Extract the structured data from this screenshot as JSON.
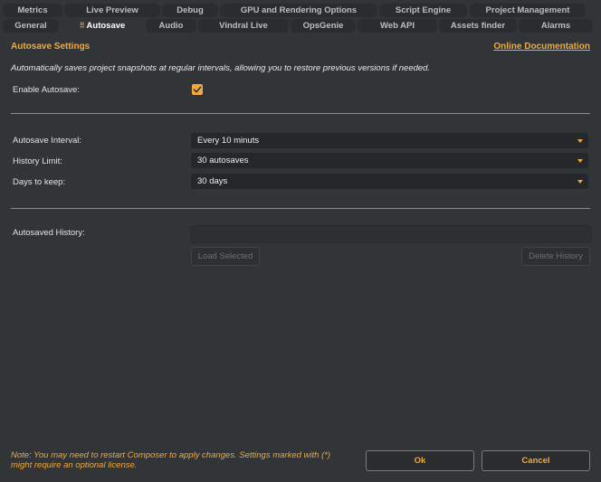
{
  "tabs_row1": [
    {
      "label": "Metrics"
    },
    {
      "label": "Live Preview"
    },
    {
      "label": "Debug"
    },
    {
      "label": "GPU and Rendering Options"
    },
    {
      "label": "Script Engine"
    },
    {
      "label": "Project Management"
    }
  ],
  "tabs_row2": [
    {
      "label": "General"
    },
    {
      "label": "Autosave",
      "active": true
    },
    {
      "label": "Audio"
    },
    {
      "label": "Vindral Live"
    },
    {
      "label": "OpsGenie"
    },
    {
      "label": "Web API"
    },
    {
      "label": "Assets finder"
    },
    {
      "label": "Alarms"
    }
  ],
  "header": {
    "title": "Autosave Settings",
    "doc_link": "Online Documentation"
  },
  "description": "Automatically saves project snapshots at regular intervals, allowing you to restore previous versions if needed.",
  "enable_autosave": {
    "label": "Enable Autosave:",
    "checked": true
  },
  "settings": {
    "interval": {
      "label": "Autosave Interval:",
      "value": "Every 10 minuts"
    },
    "history_limit": {
      "label": "History Limit:",
      "value": "30 autosaves"
    },
    "days_to_keep": {
      "label": "Days to keep:",
      "value": "30 days"
    }
  },
  "history": {
    "label": "Autosaved History:",
    "load_button": "Load Selected",
    "delete_button": "Delete History"
  },
  "footer": {
    "note_line1": "Note: You may need to restart Composer to apply changes. Settings marked with (*)",
    "note_line2": "might require an optional license.",
    "ok_label": "Ok",
    "cancel_label": "Cancel"
  },
  "colors": {
    "accent": "#f2a93b",
    "background": "#323537",
    "field": "#25272a"
  }
}
